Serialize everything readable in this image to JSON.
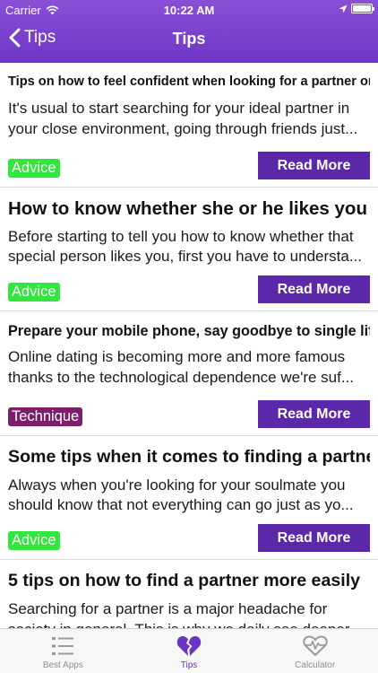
{
  "status_bar": {
    "carrier": "Carrier",
    "time": "10:22 AM"
  },
  "nav": {
    "back_label": "Tips",
    "title": "Tips"
  },
  "colors": {
    "header": "#7a42cc",
    "read_more": "#5a28a8",
    "advice_tag": "#31e63c",
    "technique_tag": "#7b1f6d",
    "tab_active": "#6a34c4"
  },
  "read_more_label": "Read More",
  "tips": [
    {
      "title": "Tips on how to feel confident when looking for a partner online",
      "body": "It's usual to start searching for your ideal partner in your close environment, going through friends just...",
      "tag": "Advice"
    },
    {
      "title": "How to know whether she or he likes you",
      "body": "Before starting to tell you how to know whether that special person likes you, first you have to understa...",
      "tag": "Advice"
    },
    {
      "title": "Prepare your mobile phone, say goodbye to single life",
      "body": "Online dating is becoming more and more famous thanks to the technological dependence we're suf...",
      "tag": "Technique"
    },
    {
      "title": "Some tips when it comes to finding a partner",
      "body": "Always when you're looking for your soulmate you should know that not everything can go just as yo...",
      "tag": "Advice"
    },
    {
      "title": "5 tips on how to find a partner more easily",
      "body": "Searching for a partner is a major headache for society in general. This is why we daily see deeper"
    }
  ],
  "tabbar": [
    {
      "label": "Best Apps",
      "icon": "list-icon",
      "active": false
    },
    {
      "label": "Tips",
      "icon": "broken-heart-icon",
      "active": true
    },
    {
      "label": "Calculator",
      "icon": "heartbeat-icon",
      "active": false
    }
  ]
}
